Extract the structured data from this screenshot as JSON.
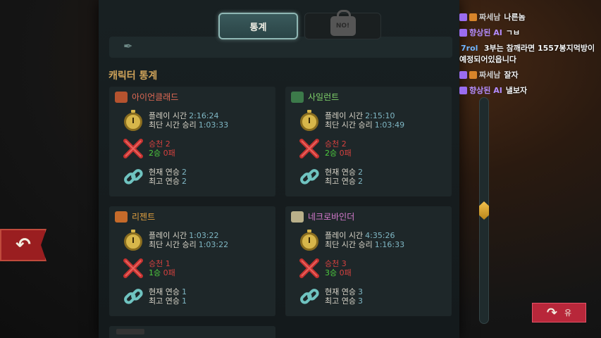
{
  "tabs": {
    "stats_label": "통계",
    "locked_label": "NO!"
  },
  "section_title": "캐릭터 통계",
  "cards": [
    {
      "name": "아이언클래드",
      "name_color": "#e06a55",
      "icon_color": "#b5532f",
      "play_time_label": "플레이 시간",
      "play_time": "2:16:24",
      "fastest_label": "최단 시간 승리",
      "fastest": "1:03:33",
      "ascension_label": "승천",
      "ascension": "2",
      "wins": "2승",
      "losses": "0패",
      "streak_label": "현재 연승",
      "streak": "2",
      "best_label": "최고 연승",
      "best": "2"
    },
    {
      "name": "사일런트",
      "name_color": "#7fd16a",
      "icon_color": "#3c7a4a",
      "play_time_label": "플레이 시간",
      "play_time": "2:15:10",
      "fastest_label": "최단 시간 승리",
      "fastest": "1:03:49",
      "ascension_label": "승천",
      "ascension": "2",
      "wins": "2승",
      "losses": "0패",
      "streak_label": "현재 연승",
      "streak": "2",
      "best_label": "최고 연승",
      "best": "2"
    },
    {
      "name": "리젠트",
      "name_color": "#e0a040",
      "icon_color": "#c56a2a",
      "play_time_label": "플레이 시간",
      "play_time": "1:03:22",
      "fastest_label": "최단 시간 승리",
      "fastest": "1:03:22",
      "ascension_label": "승천",
      "ascension": "1",
      "wins": "1승",
      "losses": "0패",
      "streak_label": "현재 연승",
      "streak": "1",
      "best_label": "최고 연승",
      "best": "1"
    },
    {
      "name": "네크로바인더",
      "name_color": "#d77bd0",
      "icon_color": "#b9b08a",
      "play_time_label": "플레이 시간",
      "play_time": "4:35:26",
      "fastest_label": "최단 시간 승리",
      "fastest": "1:16:33",
      "ascension_label": "승천",
      "ascension": "3",
      "wins": "3승",
      "losses": "0패",
      "streak_label": "현재 연승",
      "streak": "3",
      "best_label": "최고 연승",
      "best": "3"
    }
  ],
  "next_button_label": "유",
  "chat": [
    {
      "badge": "orange",
      "nick": "짜세남",
      "nick_color": "#c9c9c9",
      "msg": "나른놈"
    },
    {
      "badge": "purple",
      "nick": "향상된 AI",
      "nick_color": "#b38cff",
      "msg": "ㄱㅂ"
    },
    {
      "badge": "none",
      "nick": "7rol",
      "nick_color": "#6fb4ff",
      "msg": "3부는 참깨라면 1557봉지먹방이 예정되어있읍니다"
    },
    {
      "badge": "orange",
      "nick": "짜세남",
      "nick_color": "#c9c9c9",
      "msg": "잘자"
    },
    {
      "badge": "purple",
      "nick": "향상된 AI",
      "nick_color": "#b38cff",
      "msg": "낼보자"
    }
  ],
  "colors": {
    "accent_gold": "#d1a45a",
    "time_value": "#7fb7c4",
    "ascension_red": "#d4413f",
    "wins_green": "#4ecb3e",
    "back_red": "#9a1e20"
  },
  "icons": [
    "stopwatch-icon",
    "crossed-swords-icon",
    "chain-link-icon",
    "back-arrow-icon",
    "forward-arrow-icon",
    "lock-icon",
    "feather-icon"
  ]
}
